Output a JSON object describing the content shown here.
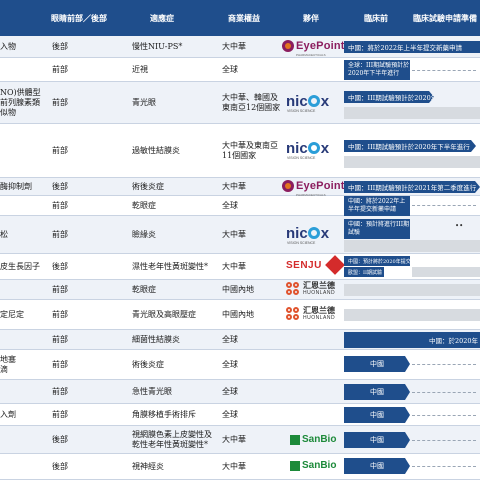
{
  "header": {
    "col_indication_region": "眼睛前部／後部",
    "col_indication": "適應症",
    "col_rights": "商業權益",
    "col_partner": "夥伴",
    "col_preclinical": "臨床前",
    "col_ind": "臨床試驗申請準備"
  },
  "rows": [
    {
      "product": "入物",
      "region": "後部",
      "indication": "慢性NIU-PS*",
      "rights": "大中華",
      "partner": "EyePoint",
      "partner_sub": "PHARMACEUTICALS",
      "status": "中國：將於2022年上半年提交新藥申請"
    },
    {
      "product": "",
      "region": "前部",
      "indication": "近視",
      "rights": "全球",
      "partner": "",
      "status": "全球：III期試驗預計於2020年下半年進行"
    },
    {
      "product": "NO)供體型前列腺素類似物",
      "region": "前部",
      "indication": "青光眼",
      "rights": "大中華、韓國及東南亞12個國家",
      "partner": "nicox",
      "partner_sub": "VISION SCIENCE",
      "status": "中國：III期試驗預計於2020年進行"
    },
    {
      "product": "",
      "region": "前部",
      "indication": "過敏性結膜炎",
      "rights": "大中華及東南亞11個國家",
      "partner": "nicox",
      "partner_sub": "VISION SCIENCE",
      "status": "中國：III期試驗預計於2020年下半年進行"
    },
    {
      "product": "酶抑制劑",
      "region": "後部",
      "indication": "術後炎症",
      "rights": "大中華",
      "partner": "EyePoint",
      "partner_sub": "PHARMACEUTICALS",
      "status": "中國：III期試驗預計於2021年第二季度進行"
    },
    {
      "product": "",
      "region": "前部",
      "indication": "乾眼症",
      "rights": "全球",
      "partner": "",
      "status": ""
    },
    {
      "product": "松",
      "region": "前部",
      "indication": "瞼緣炎",
      "rights": "大中華",
      "partner": "nicox",
      "partner_sub": "VISION SCIENCE",
      "status": "中國：預計於2021年上半年提交新藥申請",
      "status2": "中國：預計將進行III期試驗"
    },
    {
      "product": "皮生長因子",
      "region": "後部",
      "indication": "濕性老年性黃斑變性*",
      "rights": "大中華",
      "partner": "SENJU",
      "partner_sub": "SENJU PHARMACEUTICAL",
      "status": "中國：預計將於2020年提交臨床試驗申請",
      "status2": "歐盟：II期試驗"
    },
    {
      "product": "",
      "region": "前部",
      "indication": "乾眼症",
      "rights": "中國內地",
      "partner": "汇恩兰德",
      "partner_sub": "HUONLAND",
      "status": ""
    },
    {
      "product": "定尼定",
      "region": "前部",
      "indication": "青光眼及高眼壓症",
      "rights": "中國內地",
      "partner": "汇恩兰德",
      "partner_sub": "HUONLAND",
      "status": ""
    },
    {
      "product": "",
      "region": "前部",
      "indication": "細菌性結膜炎",
      "rights": "全球",
      "partner": "",
      "status": "中國：於2020年"
    },
    {
      "product": "地塞\n滴",
      "region": "前部",
      "indication": "術後炎症",
      "rights": "全球",
      "partner": "",
      "status": "中國"
    },
    {
      "product": "",
      "region": "前部",
      "indication": "急性青光眼",
      "rights": "全球",
      "partner": "",
      "status": "中國"
    },
    {
      "product": "入劑",
      "region": "前部",
      "indication": "角膜移植手術排斥",
      "rights": "全球",
      "partner": "",
      "status": "中國"
    },
    {
      "product": "",
      "region": "後部",
      "indication": "視網膜色素上皮變性及乾性老年性黃斑變性*",
      "rights": "大中華",
      "partner": "SanBio",
      "partner_sub": "",
      "status": "中國"
    },
    {
      "product": "",
      "region": "後部",
      "indication": "視神經炎",
      "rights": "大中華",
      "partner": "SanBio",
      "partner_sub": "",
      "status": "中國"
    }
  ],
  "colors": {
    "header_bg": "#1f4e8c",
    "bar": "#1f4e8c",
    "pending": "#d7dbe0",
    "row_shade": "#eef2f8"
  },
  "icons": [
    "eyepoint-logo",
    "nicox-logo",
    "senju-logo",
    "huonland-logo",
    "sanbio-logo"
  ]
}
